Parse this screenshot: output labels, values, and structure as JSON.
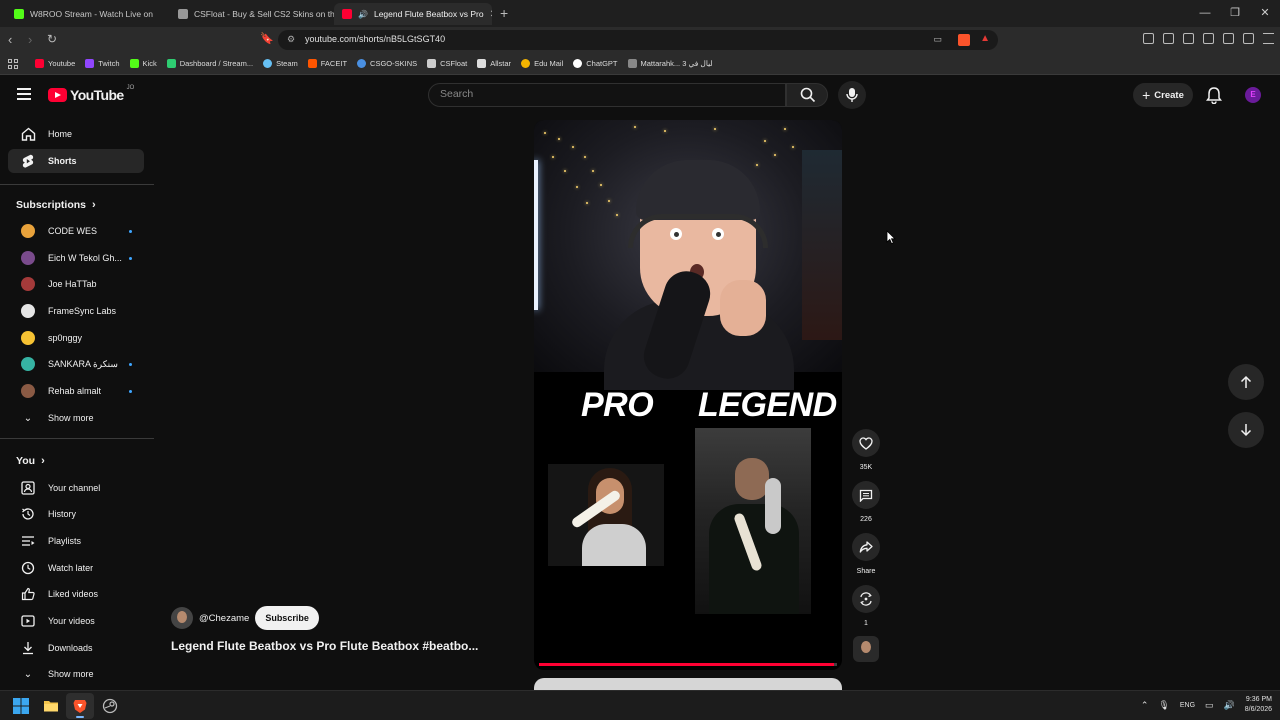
{
  "browser": {
    "tabs": [
      {
        "title": "W8ROO Stream - Watch Live on",
        "favicon_color": "#53fc18"
      },
      {
        "title": "CSFloat - Buy & Sell CS2 Skins on the",
        "favicon_color": "#cccccc"
      },
      {
        "title": "Legend Flute Beatbox vs Pro",
        "favicon_color": "#ff0033"
      }
    ],
    "url": "youtube.com/shorts/nB5LGtSGT40",
    "bookmarks": [
      {
        "label": "Youtube",
        "color": "#ff0033"
      },
      {
        "label": "Twitch",
        "color": "#9146ff"
      },
      {
        "label": "Kick",
        "color": "#53fc18"
      },
      {
        "label": "Dashboard / Stream...",
        "color": "#2ecc71"
      },
      {
        "label": "Steam",
        "color": "#66c0f4"
      },
      {
        "label": "FACEIT",
        "color": "#ff5500"
      },
      {
        "label": "CSGO-SKINS",
        "color": "#4a90e2"
      },
      {
        "label": "CSFloat",
        "color": "#cccccc"
      },
      {
        "label": "Allstar",
        "color": "#dddddd"
      },
      {
        "label": "Edu Mail",
        "color": "#f4b400"
      },
      {
        "label": "ChatGPT",
        "color": "#ffffff"
      },
      {
        "label": "Mattarahk... ليال في 3",
        "color": "#888888"
      }
    ]
  },
  "header": {
    "logo_text": "YouTube",
    "country_code": "JO",
    "search_placeholder": "Search",
    "create_label": "Create",
    "avatar_letter": "E"
  },
  "sidebar": {
    "main": [
      {
        "label": "Home",
        "icon": "home-icon"
      },
      {
        "label": "Shorts",
        "icon": "shorts-icon",
        "active": true
      }
    ],
    "subscriptions_title": "Subscriptions",
    "subscriptions": [
      {
        "label": "CODE WES",
        "color": "#e8a23b",
        "dot": true
      },
      {
        "label": "Eich W Tekol Gh...",
        "color": "#7a4b8c",
        "dot": true
      },
      {
        "label": "Joe HaTTab",
        "color": "#a43a3a",
        "dot": false
      },
      {
        "label": "FrameSync Labs",
        "color": "#e5e5e5",
        "dot": false
      },
      {
        "label": "sp0nggy",
        "color": "#f6c233",
        "dot": false
      },
      {
        "label": "SANKARA سنكرة",
        "color": "#36b3a3",
        "dot": true
      },
      {
        "label": "Rehab almalt",
        "color": "#8a5a44",
        "dot": true
      }
    ],
    "show_more_1": "Show more",
    "you_title": "You",
    "you_items": [
      {
        "label": "Your channel",
        "icon": "channel-icon"
      },
      {
        "label": "History",
        "icon": "history-icon"
      },
      {
        "label": "Playlists",
        "icon": "playlists-icon"
      },
      {
        "label": "Watch later",
        "icon": "watch-later-icon"
      },
      {
        "label": "Liked videos",
        "icon": "like-icon"
      },
      {
        "label": "Your videos",
        "icon": "your-videos-icon"
      },
      {
        "label": "Downloads",
        "icon": "download-icon"
      }
    ],
    "show_more_2": "Show more"
  },
  "short": {
    "overlay_left": "PRO",
    "overlay_right": "LEGEND",
    "channel": "@Chezame",
    "subscribe_label": "Subscribe",
    "title": "Legend Flute Beatbox vs Pro Flute Beatbox #beatbo...",
    "progress_fraction": 0.99,
    "accent_color": "#ff0033"
  },
  "actions": {
    "likes": "35K",
    "comments": "226",
    "share_label": "Share",
    "remix_count": "1"
  },
  "taskbar": {
    "language": "ENG",
    "time": "9:36 PM",
    "date": "8/6/2026"
  }
}
